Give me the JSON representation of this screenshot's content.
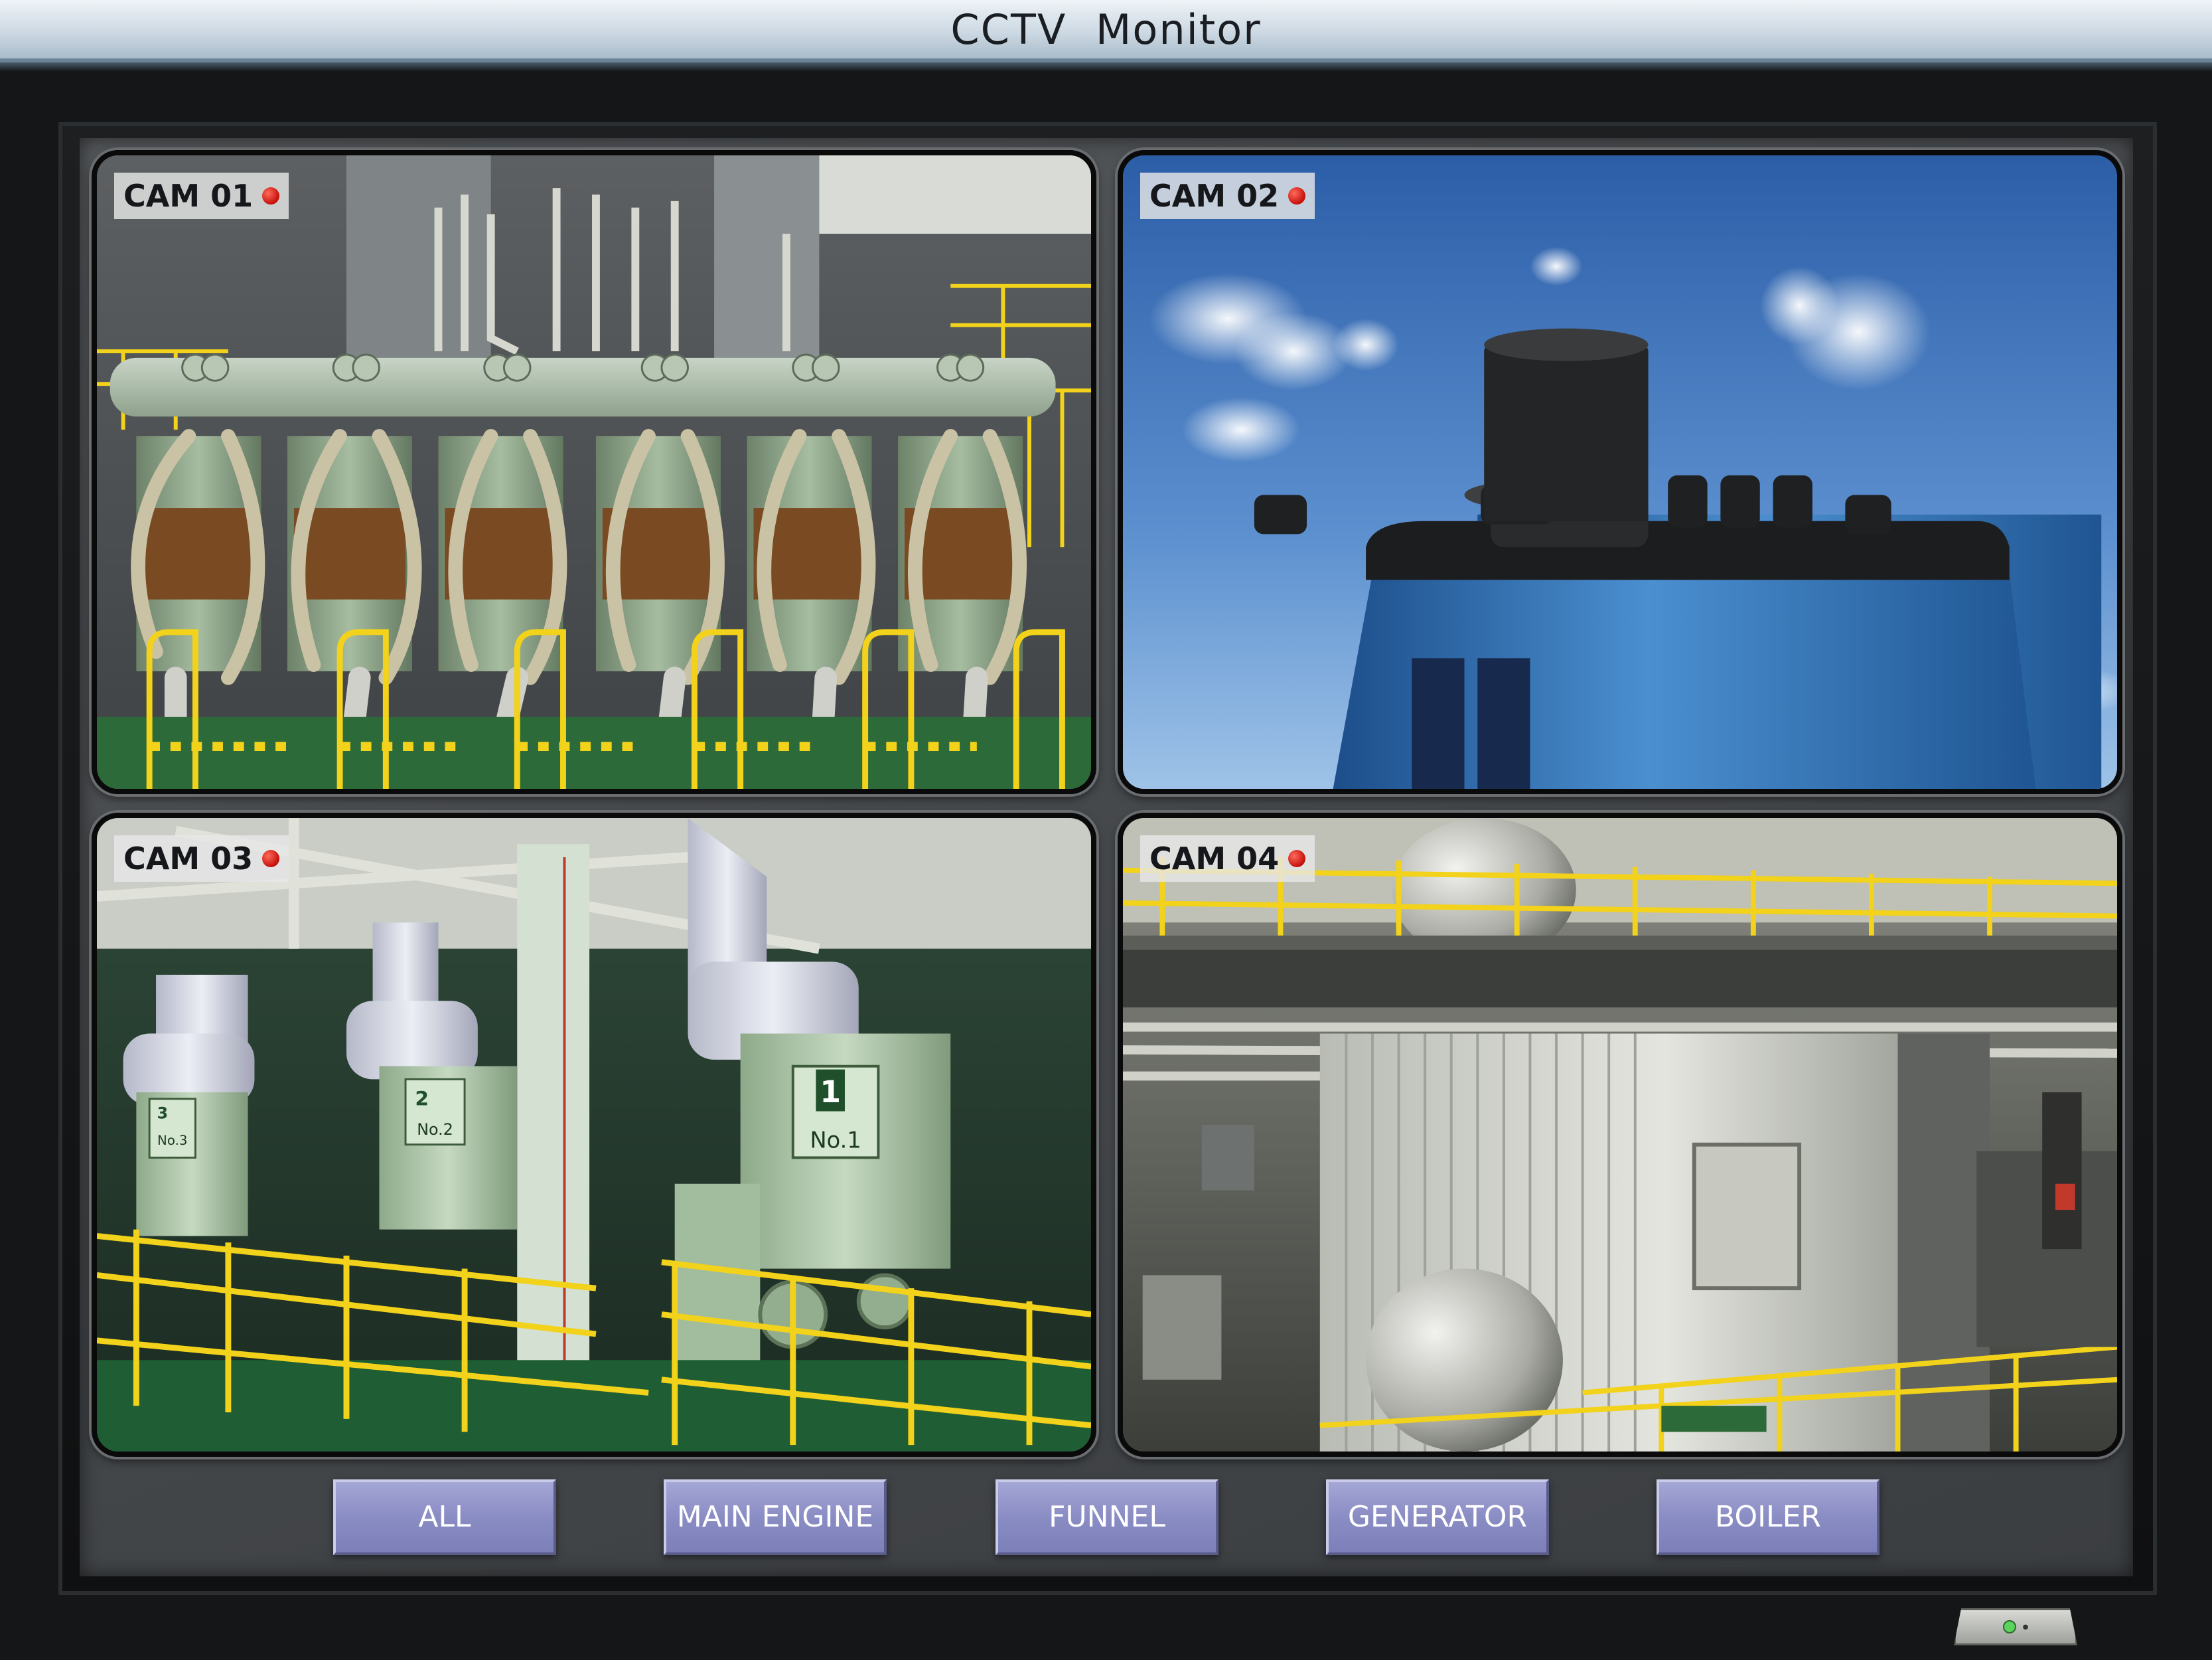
{
  "window": {
    "title": "CCTV   Monitor"
  },
  "cameras": [
    {
      "label": "CAM 01",
      "scene": "main-engine"
    },
    {
      "label": "CAM 02",
      "scene": "funnel"
    },
    {
      "label": "CAM 03",
      "scene": "generator"
    },
    {
      "label": "CAM 04",
      "scene": "boiler"
    }
  ],
  "scene_text": {
    "gen1_num": "1",
    "gen1_name": "No.1",
    "gen2_num": "2",
    "gen2_name": "No.2",
    "gen3_num": "3",
    "gen3_name": "No.3"
  },
  "buttons": [
    {
      "label": "ALL"
    },
    {
      "label": "MAIN ENGINE"
    },
    {
      "label": "FUNNEL"
    },
    {
      "label": "GENERATOR"
    },
    {
      "label": "BOILER"
    }
  ],
  "colors": {
    "recording_dot": "#c4100a",
    "button_face": "#8a8cc4",
    "railing": "#f2d21a",
    "machinery_green": "#9fb79a"
  }
}
